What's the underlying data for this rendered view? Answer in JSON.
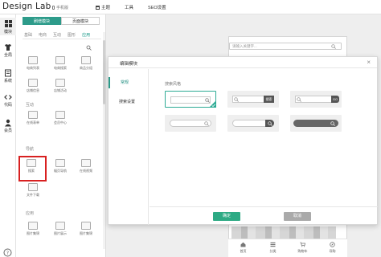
{
  "app": {
    "brand": "Design Lab",
    "phone_version": "手机版"
  },
  "topnav": [
    {
      "label": "主题"
    },
    {
      "label": "工具"
    },
    {
      "label": "SEO设置"
    }
  ],
  "rail": [
    {
      "label": "模块",
      "icon": "grid-icon"
    },
    {
      "label": "全局",
      "icon": "shirt-icon"
    },
    {
      "label": "系统",
      "icon": "document-icon"
    },
    {
      "label": "代码",
      "icon": "code-icon"
    },
    {
      "label": "会员",
      "icon": "user-icon"
    }
  ],
  "panel": {
    "tabs": [
      "刷增模块",
      "页面模块"
    ],
    "categories": [
      "基础",
      "电商",
      "互动",
      "图形",
      "应用"
    ],
    "active_category": "应用",
    "row1": [
      "电商列表",
      "电商搜索",
      "商品分组"
    ],
    "row2": [
      "店铺信息",
      "店铺活动"
    ],
    "section_interact": "互动",
    "row3": [
      "在线表单",
      "会员中心"
    ],
    "section_nav": "导航",
    "row4": [
      "搜索",
      "幅页导航",
      "在线视频"
    ],
    "row5": [
      "文件下载"
    ],
    "section_app": "应用",
    "row6": [
      "图片集锦",
      "图片展示",
      "图片集锦"
    ]
  },
  "phone_preview": {
    "search_placeholder": "请输入关键字...",
    "nav": [
      "首页",
      "分类",
      "购物车",
      "导购"
    ]
  },
  "modal": {
    "title": "编辑模块",
    "close": "×",
    "tabs": [
      "常规",
      "搜索设置"
    ],
    "style_label": "搜索风格",
    "styles": [
      {
        "button": ""
      },
      {
        "button": "搜索"
      },
      {
        "button": "GO"
      },
      {
        "button": ""
      },
      {
        "button": ""
      },
      {
        "button": ""
      }
    ],
    "ok_label": "确定",
    "cancel_label": "取消"
  },
  "colors": {
    "accent": "#2d9b8a",
    "highlight": "#d82020",
    "ok": "#2daa84"
  }
}
